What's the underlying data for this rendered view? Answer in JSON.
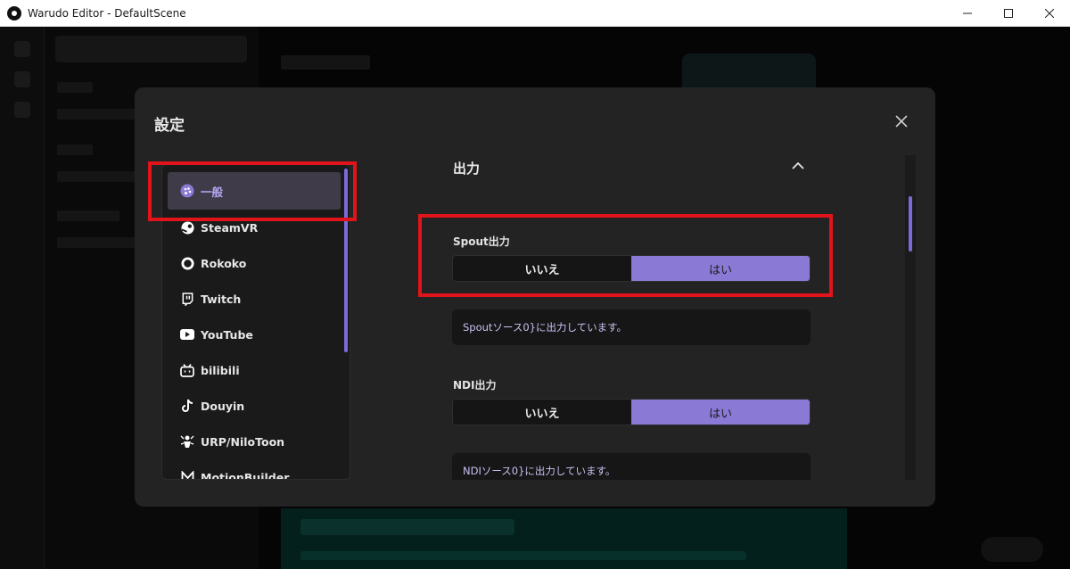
{
  "window": {
    "title": "Warudo Editor - DefaultScene"
  },
  "dialog": {
    "title": "設定",
    "sidebar": {
      "items": [
        {
          "label": "一般",
          "icon": "palette-icon",
          "active": true
        },
        {
          "label": "SteamVR",
          "icon": "steam-icon"
        },
        {
          "label": "Rokoko",
          "icon": "rokoko-icon"
        },
        {
          "label": "Twitch",
          "icon": "twitch-icon"
        },
        {
          "label": "YouTube",
          "icon": "youtube-icon"
        },
        {
          "label": "bilibili",
          "icon": "bilibili-icon"
        },
        {
          "label": "Douyin",
          "icon": "tiktok-icon"
        },
        {
          "label": "URP/NiloToon",
          "icon": "nilotoon-icon"
        },
        {
          "label": "MotionBuilder",
          "icon": "motionbuilder-icon"
        }
      ]
    },
    "section": {
      "title": "出力",
      "spout": {
        "label": "Spout出力",
        "no": "いいえ",
        "yes": "はい",
        "selected": "はい",
        "info": "Spoutソース0}に出力しています。"
      },
      "ndi": {
        "label": "NDI出力",
        "no": "いいえ",
        "yes": "はい",
        "selected": "はい",
        "info": "NDIソース0}に出力しています。"
      }
    }
  },
  "colors": {
    "accent": "#8a7ad6",
    "highlight": "#e0141a",
    "dialog_bg": "#232323"
  }
}
